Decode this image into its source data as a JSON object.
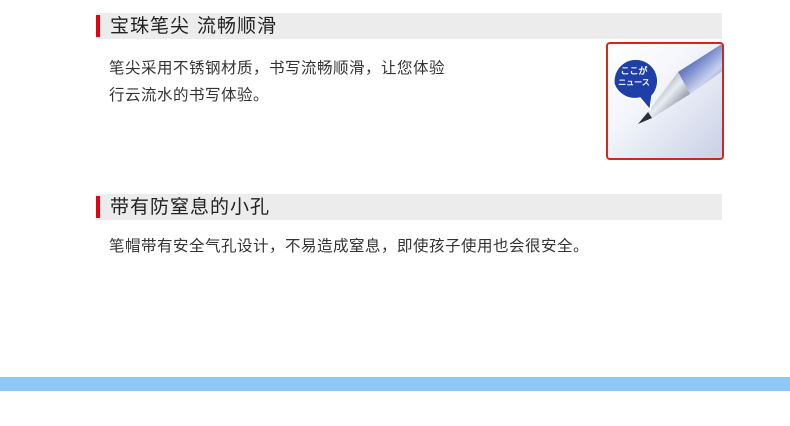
{
  "section1": {
    "title": "宝珠笔尖 流畅顺滑",
    "line1": "笔尖采用不锈钢材质，书写流畅顺滑，让您体验",
    "line2": "行云流水的书写体验。",
    "badge_line1": "ここが",
    "badge_line2": "ニュース"
  },
  "section2": {
    "title": "带有防窒息的小孔",
    "line1": "笔帽带有安全气孔设计，不易造成窒息，即使孩子使用也会很安全。"
  },
  "colors": {
    "accent_red": "#e60012",
    "header_bg": "#ececec",
    "stripe_blue": "#8ec8f4"
  },
  "icons": {
    "speech_badge": "speech-bubble-icon"
  }
}
